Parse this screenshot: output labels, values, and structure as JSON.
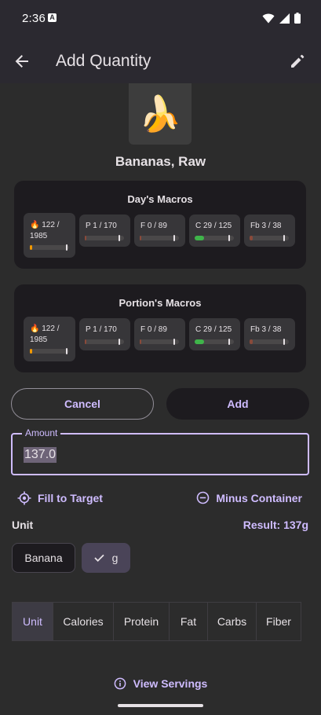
{
  "status": {
    "time": "2:36",
    "notif_letter": "A"
  },
  "appbar": {
    "title": "Add Quantity"
  },
  "food": {
    "name": "Bananas, Raw",
    "emoji": "🍌"
  },
  "colors": {
    "accent": "#cfbcff",
    "calorie_bar": "#f29900",
    "carb_bar": "#3fb44a",
    "neutral_bar": "#8a4a3a"
  },
  "day_macros": {
    "title": "Day's Macros",
    "calories": {
      "label": "🔥 122 / 1985",
      "value": 122,
      "target": 1985
    },
    "protein": {
      "label": "P 1 / 170",
      "value": 1,
      "target": 170
    },
    "fat": {
      "label": "F 0 / 89",
      "value": 0,
      "target": 89
    },
    "carbs": {
      "label": "C 29 / 125",
      "value": 29,
      "target": 125
    },
    "fiber": {
      "label": "Fb 3 / 38",
      "value": 3,
      "target": 38
    }
  },
  "portion_macros": {
    "title": "Portion's Macros",
    "calories": {
      "label": "🔥 122 / 1985",
      "value": 122,
      "target": 1985
    },
    "protein": {
      "label": "P 1 / 170",
      "value": 1,
      "target": 170
    },
    "fat": {
      "label": "F 0 / 89",
      "value": 0,
      "target": 89
    },
    "carbs": {
      "label": "C 29 / 125",
      "value": 29,
      "target": 125
    },
    "fiber": {
      "label": "Fb 3 / 38",
      "value": 3,
      "target": 38
    }
  },
  "actions": {
    "cancel": "Cancel",
    "add": "Add"
  },
  "amount": {
    "label": "Amount",
    "value": "137.0"
  },
  "helpers": {
    "fill_target": "Fill to Target",
    "minus_container": "Minus Container"
  },
  "unit": {
    "label": "Unit",
    "result": "Result: 137g",
    "options": [
      "Banana",
      "g"
    ],
    "selected": "g"
  },
  "tabs": [
    "Unit",
    "Calories",
    "Protein",
    "Fat",
    "Carbs",
    "Fiber"
  ],
  "footer": {
    "view_servings": "View Servings"
  }
}
